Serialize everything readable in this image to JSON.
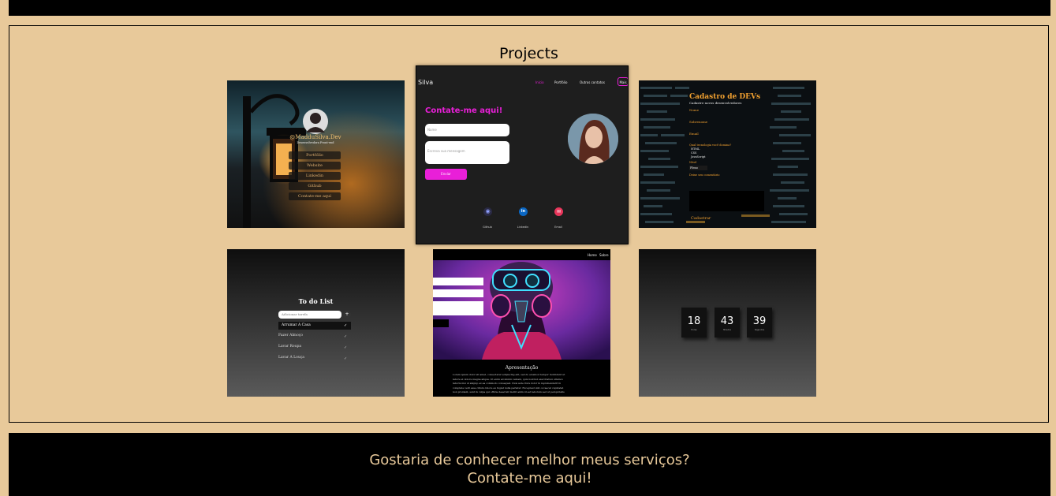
{
  "section": {
    "title": "Projects"
  },
  "linktree": {
    "handle": "@MadduSilva.Dev",
    "subtitle": "Desenvolvedora Front-end",
    "links": [
      "Portfólio",
      "Website",
      "Linkedin",
      "Github",
      "Contate-me aqui"
    ]
  },
  "portfolio": {
    "logo": "Silva",
    "nav": [
      "Início",
      "Portfólio",
      "Outros contatos",
      "Mais"
    ],
    "heading": "Contate-me aqui!",
    "name_placeholder": "Nome",
    "message_placeholder": "Escreva sua mensagem",
    "send": "Enviar",
    "socials": [
      "Github",
      "Linkedin",
      "Email"
    ],
    "social_glyphs": [
      "◉",
      "in",
      "✉"
    ]
  },
  "devs": {
    "title": "Cadastro de DEVs",
    "subtitle": "Cadastre novos desenvolvedores",
    "fields": [
      "Nome",
      "Sobrenome",
      "Email"
    ],
    "tech_question": "Qual tecnologia você domina?",
    "techs": [
      "HTML",
      "CSS",
      "JavaScript"
    ],
    "level": "Nível",
    "level_value": "Pleno",
    "question2": "Deixe seu comentário",
    "submit": "Cadastrar"
  },
  "todo": {
    "title": "To do List",
    "input_placeholder": "Adicionar tarefa",
    "add": "+",
    "items": [
      "Arrumar A Casa",
      "Fazer Almoço",
      "Lavar Roupa",
      "Lavar A Louça"
    ]
  },
  "cyber": {
    "nav": [
      "Home",
      "Sobre"
    ],
    "heading": "Apresentação",
    "text_lines": [
      "Lorem ipsum dolor sit amet, consectetur adipiscing elit, sed do eiusmod tempor incididunt ut",
      "labore et dolore magna aliqua. Ut enim ad minim veniam, quis nostrud exercitation ullamco",
      "laboris nisi ut aliquip ex ea commodo consequat. Duis aute irure dolor in reprehenderit in",
      "voluptate velit esse cillum dolore eu fugiat nulla pariatur. Excepteur sint occaecat cupidatat",
      "non proident, sunt in culpa qui officia deserunt mollit anim id est laborum sed ut perspiciatis"
    ]
  },
  "timer": {
    "values": [
      "18",
      "43",
      "39"
    ],
    "labels": [
      "Horas",
      "Minutos",
      "Segundos"
    ]
  },
  "footer": {
    "line1": "Gostaria de conhecer melhor meus serviços?",
    "line2": "Contate-me aqui!"
  },
  "colors": {
    "page_bg": "#e8c99a",
    "accent_magenta": "#e91fd8",
    "devs_orange": "#f0a030",
    "footer_text": "#e8c99a"
  }
}
